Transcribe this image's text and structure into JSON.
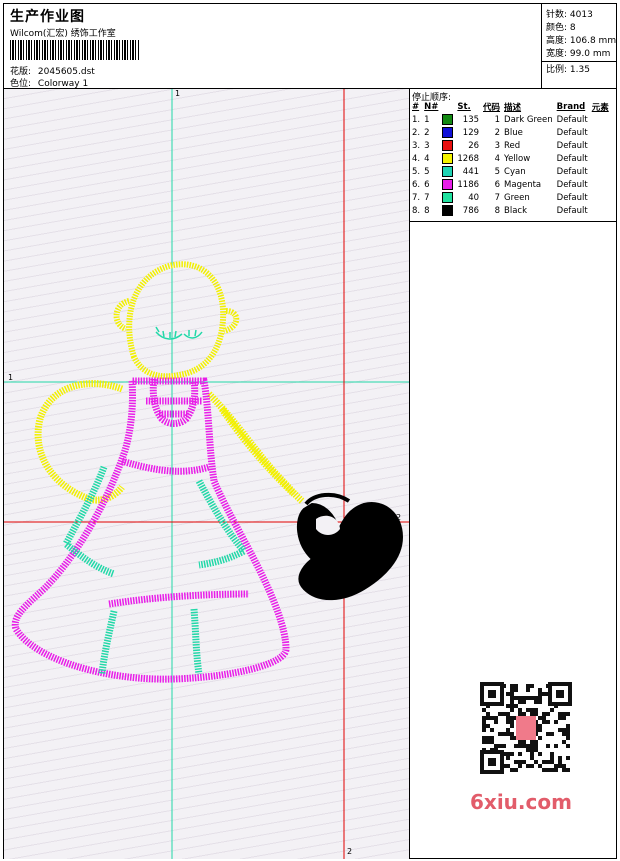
{
  "header": {
    "title": "生产作业图",
    "company": "Wilcom(汇宏) 绣饰工作室",
    "design_label": "花版:",
    "design_file": "2045605.dst",
    "colorway_label": "色位:",
    "colorway": "Colorway 1"
  },
  "info": {
    "stitches_label": "针数:",
    "stitches": "4013",
    "colors_label": "颜色:",
    "colors": "8",
    "height_label": "高度:",
    "height": "106.8 mm",
    "width_label": "宽度:",
    "width": "99.0 mm",
    "ratio_label": "比例:",
    "ratio": "1.35"
  },
  "axes": {
    "top_label": "1",
    "left_label": "1",
    "right_label": "2",
    "bottom_label": "2"
  },
  "stop_sequence": {
    "title": "停止顺序:",
    "headers": [
      "#",
      "N#",
      "",
      "St.",
      "代码",
      "描述",
      "Brand",
      "元素"
    ],
    "rows": [
      {
        "idx": "1.",
        "n": "1",
        "color": "#138a13",
        "st": "135",
        "code": "1",
        "desc": "Dark Green",
        "brand": "Default"
      },
      {
        "idx": "2.",
        "n": "2",
        "color": "#1010d8",
        "st": "129",
        "code": "2",
        "desc": "Blue",
        "brand": "Default"
      },
      {
        "idx": "3.",
        "n": "3",
        "color": "#e81010",
        "st": "26",
        "code": "3",
        "desc": "Red",
        "brand": "Default"
      },
      {
        "idx": "4.",
        "n": "4",
        "color": "#f4f400",
        "st": "1268",
        "code": "4",
        "desc": "Yellow",
        "brand": "Default"
      },
      {
        "idx": "5.",
        "n": "5",
        "color": "#1ed4b4",
        "st": "441",
        "code": "5",
        "desc": "Cyan",
        "brand": "Default"
      },
      {
        "idx": "6.",
        "n": "6",
        "color": "#e81ee8",
        "st": "1186",
        "code": "6",
        "desc": "Magenta",
        "brand": "Default"
      },
      {
        "idx": "7.",
        "n": "7",
        "color": "#20e2a0",
        "st": "40",
        "code": "7",
        "desc": "Green",
        "brand": "Default"
      },
      {
        "idx": "8.",
        "n": "8",
        "color": "#000000",
        "st": "786",
        "code": "8",
        "desc": "Black",
        "brand": "Default"
      }
    ]
  },
  "watermark": "6xiu.com",
  "qr_icon": "qr-code-icon"
}
